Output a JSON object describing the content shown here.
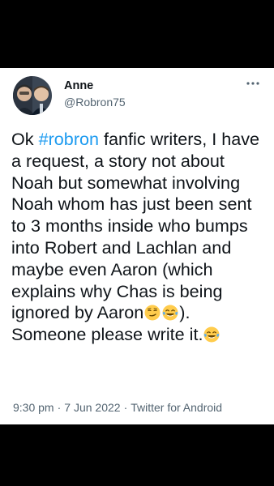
{
  "author": {
    "name": "Anne",
    "handle": "@Robron75"
  },
  "tweet": {
    "text_before_hashtag": "Ok ",
    "hashtag": "#robron",
    "text_after_hashtag": " fanfic writers, I have a request, a story not about Noah but somewhat involving Noah whom has just been sent to 3 months inside who bumps into Robert and Lachlan and maybe even Aaron (which explains why Chas is being ignored by Aaron",
    "text_after_emojis": "). Someone please write it.",
    "emojis": [
      "smirking-face-emoji",
      "face-with-tears-of-joy-emoji",
      "face-with-tears-of-joy-emoji"
    ]
  },
  "meta": {
    "time": "9:30 pm",
    "separator": "·",
    "date": "7 Jun 2022",
    "source": "Twitter for Android"
  },
  "colors": {
    "background": "#000000",
    "card": "#ffffff",
    "text": "#0f1419",
    "secondary_text": "#536471",
    "accent": "#1d9bf0"
  },
  "icons": {
    "more": "more-options-icon"
  }
}
